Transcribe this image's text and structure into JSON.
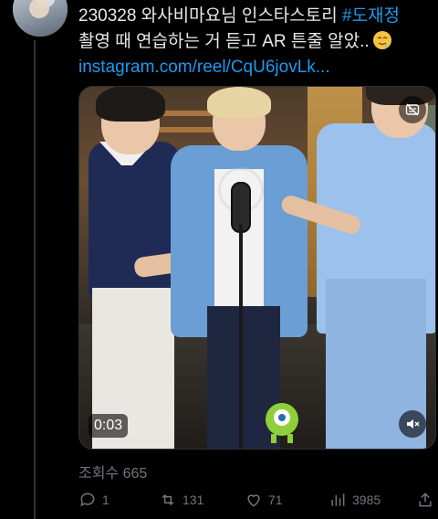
{
  "tweet": {
    "line1_text": "230328 와사비마요님 인스타스토리 ",
    "hashtag": "#도재정",
    "line2_text": "촬영 때 연습하는 거 듣고 AR 튼줄 알았..",
    "emoji_name": "drooling-face-emoji",
    "link": "instagram.com/reel/CqU6jovLk..."
  },
  "media": {
    "timestamp": "0:03",
    "mute_icon": "speaker-muted-icon",
    "gif_icon": "captions-off-icon"
  },
  "views": {
    "label": "조회수 665"
  },
  "actions": {
    "reply": {
      "icon": "reply-icon",
      "count": "1"
    },
    "retweet": {
      "icon": "retweet-icon",
      "count": "131"
    },
    "like": {
      "icon": "heart-icon",
      "count": "71"
    },
    "views": {
      "icon": "bar-chart-icon",
      "count": "3985"
    },
    "share": {
      "icon": "share-icon"
    }
  },
  "colors": {
    "background": "#000000",
    "text": "#e7e9ea",
    "accent": "#1d9bf0",
    "muted": "#71767b"
  }
}
